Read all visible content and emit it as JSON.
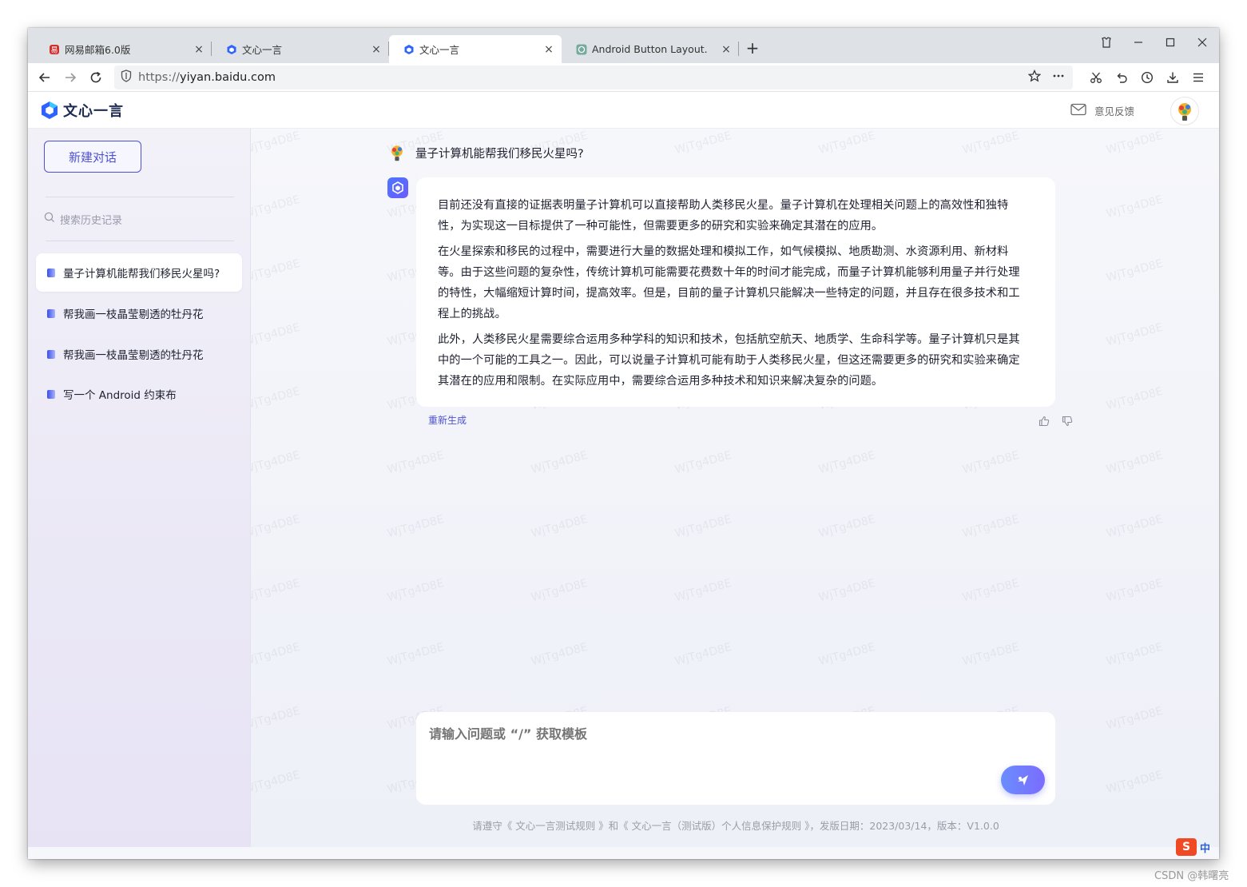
{
  "browser": {
    "tabs": [
      {
        "title": "网易邮箱6.0版",
        "icon": "netease-mail-icon",
        "close": "×"
      },
      {
        "title": "文心一言",
        "icon": "wenxin-icon",
        "close": "×"
      },
      {
        "title": "文心一言",
        "icon": "wenxin-icon",
        "close": "×"
      },
      {
        "title": "Android Button Layout.",
        "icon": "chatgpt-icon",
        "close": "×"
      }
    ],
    "new_tab": "+",
    "url_scheme": "https://",
    "url_host": "yiyan.baidu.com",
    "colors": {
      "tab_strip": "#dee1e6",
      "active_tab": "#ffffff"
    }
  },
  "app": {
    "brand": "文心一言",
    "feedback": "意见反馈",
    "accent": "#4e51d6"
  },
  "sidebar": {
    "new_chat": "新建对话",
    "search_placeholder": "搜索历史记录",
    "history": [
      {
        "label": "量子计算机能帮我们移民火星吗?",
        "active": true
      },
      {
        "label": "帮我画一枝晶莹剔透的牡丹花",
        "active": false
      },
      {
        "label": "帮我画一枝晶莹剔透的牡丹花",
        "active": false
      },
      {
        "label": "写一个 Android 约束布",
        "active": false
      }
    ]
  },
  "chat": {
    "question": "量子计算机能帮我们移民火星吗?",
    "answer": [
      "目前还没有直接的证据表明量子计算机可以直接帮助人类移民火星。量子计算机在处理相关问题上的高效性和独特性，为实现这一目标提供了一种可能性，但需要更多的研究和实验来确定其潜在的应用。",
      "在火星探索和移民的过程中，需要进行大量的数据处理和模拟工作，如气候模拟、地质勘测、水资源利用、新材料等。由于这些问题的复杂性，传统计算机可能需要花费数十年的时间才能完成，而量子计算机能够利用量子并行处理的特性，大幅缩短计算时间，提高效率。但是，目前的量子计算机只能解决一些特定的问题，并且存在很多技术和工程上的挑战。",
      "此外，人类移民火星需要综合运用多种学科的知识和技术，包括航空航天、地质学、生命科学等。量子计算机只是其中的一个可能的工具之一。因此，可以说量子计算机可能有助于人类移民火星，但这还需要更多的研究和实验来确定其潜在的应用和限制。在实际应用中，需要综合运用多种技术和知识来解决复杂的问题。"
    ],
    "regenerate": "重新生成",
    "input_placeholder": "请输入问题或 “/” 获取模板",
    "footer": "请遵守《 文心一言测试规则 》和《 文心一言（测试版）个人信息保护规则 》，发版日期：2023/03/14，版本：V1.0.0"
  },
  "watermark": "WjTg4D8E",
  "ime": {
    "logo": "S",
    "mode": "中"
  },
  "credit": "CSDN @韩曙亮"
}
